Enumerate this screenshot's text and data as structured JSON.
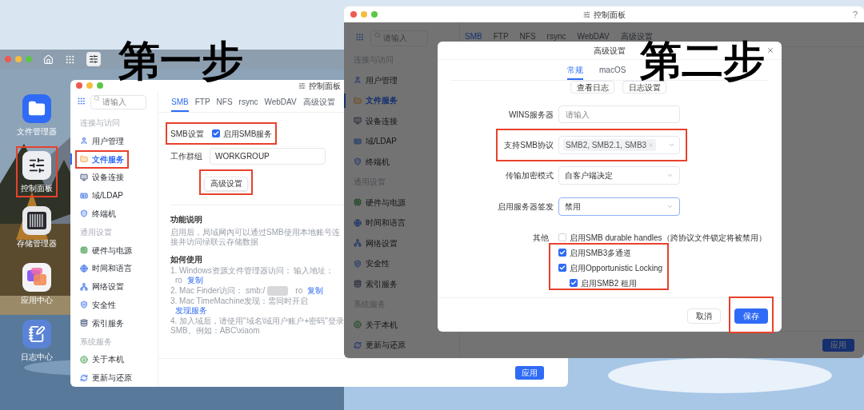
{
  "step_labels": [
    {
      "text": "第一步"
    },
    {
      "text": "第二步"
    }
  ],
  "desktop": {
    "dock": [
      {
        "kind": "files",
        "label": "文件管理器"
      },
      {
        "kind": "control",
        "label": "控制面板"
      },
      {
        "kind": "storage",
        "label": "存储管理器"
      },
      {
        "kind": "apps",
        "label": "应用中心"
      },
      {
        "kind": "logs",
        "label": "日志中心"
      }
    ]
  },
  "window_1": {
    "title": "控制面板",
    "search": {
      "placeholder": "请输入"
    },
    "sidebar": [
      {
        "kind": "group",
        "label": "连接与访问"
      },
      {
        "kind": "item",
        "label": "用户管理",
        "selected": false
      },
      {
        "kind": "item",
        "label": "文件服务",
        "selected": true
      },
      {
        "kind": "item",
        "label": "设备连接",
        "selected": false
      },
      {
        "kind": "item",
        "label": "域/LDAP",
        "selected": false
      },
      {
        "kind": "item",
        "label": "终端机",
        "selected": false
      },
      {
        "kind": "group",
        "label": "通用设置"
      },
      {
        "kind": "item",
        "label": "硬件与电源",
        "selected": false
      },
      {
        "kind": "item",
        "label": "时间和语言",
        "selected": false
      },
      {
        "kind": "item",
        "label": "网络设置",
        "selected": false
      },
      {
        "kind": "item",
        "label": "安全性",
        "selected": false
      },
      {
        "kind": "item",
        "label": "索引服务",
        "selected": false
      },
      {
        "kind": "group",
        "label": "系统服务"
      },
      {
        "kind": "item",
        "label": "关于本机",
        "selected": false
      },
      {
        "kind": "item",
        "label": "更新与还原",
        "selected": false
      }
    ],
    "tabs": [
      {
        "label": "SMB",
        "selected": true
      },
      {
        "label": "FTP",
        "selected": false
      },
      {
        "label": "NFS",
        "selected": false
      },
      {
        "label": "rsync",
        "selected": false
      },
      {
        "label": "WebDAV",
        "selected": false
      },
      {
        "label": "高级设置",
        "selected": false
      }
    ],
    "smb_settings": {
      "label": "SMB设置",
      "checkbox": {
        "label": "启用SMB服务",
        "checked": true
      }
    },
    "workgroup": {
      "label": "工作群组",
      "value": "WORKGROUP"
    },
    "advanced_button": "高级设置",
    "description": {
      "title": "功能说明",
      "text": "启用后，局域网内可以通过SMB使用本地账号连接并访问绿联云存储数据"
    },
    "usage": {
      "title": "如何使用",
      "steps": [
        {
          "text": "1. Windows资源文件管理器访问：  输入地址：",
          "redacted": false,
          "address": "ro",
          "link": "复制"
        },
        {
          "text": "2. Mac Finder访问：  smb:/",
          "redacted": true,
          "address": "ro",
          "link": "复制"
        },
        {
          "text": "3. Mac TimeMachine发现：需同时开启",
          "redacted": false,
          "link": "发现服务"
        },
        {
          "text": "4. 加入域后，请使用\"域名\\域用户账户+密码\"登录 SMB。例如：ABC\\xiaom",
          "redacted": false
        }
      ]
    },
    "apply_button": "应用"
  },
  "window_2": {
    "title": "控制面板",
    "help": "?",
    "search": {
      "placeholder": "请输入"
    },
    "sidebar": [
      {
        "kind": "group",
        "label": "连接与访问"
      },
      {
        "kind": "item",
        "label": "用户管理",
        "selected": false
      },
      {
        "kind": "item",
        "label": "文件服务",
        "selected": true
      },
      {
        "kind": "item",
        "label": "设备连接",
        "selected": false
      },
      {
        "kind": "item",
        "label": "域/LDAP",
        "selected": false
      },
      {
        "kind": "item",
        "label": "终端机",
        "selected": false
      },
      {
        "kind": "group",
        "label": "通用设置"
      },
      {
        "kind": "item",
        "label": "硬件与电源",
        "selected": false
      },
      {
        "kind": "item",
        "label": "时间和语言",
        "selected": false
      },
      {
        "kind": "item",
        "label": "网络设置",
        "selected": false
      },
      {
        "kind": "item",
        "label": "安全性",
        "selected": false
      },
      {
        "kind": "item",
        "label": "索引服务",
        "selected": false
      },
      {
        "kind": "group",
        "label": "系统服务"
      },
      {
        "kind": "item",
        "label": "关于本机",
        "selected": false
      },
      {
        "kind": "item",
        "label": "更新与还原",
        "selected": false
      }
    ],
    "tabs": [
      {
        "label": "SMB",
        "selected": true
      },
      {
        "label": "FTP",
        "selected": false
      },
      {
        "label": "NFS",
        "selected": false
      },
      {
        "label": "rsync",
        "selected": false
      },
      {
        "label": "WebDAV",
        "selected": false
      },
      {
        "label": "高级设置",
        "selected": false
      }
    ],
    "apply_button": "应用",
    "dialog": {
      "title": "高级设置",
      "tabs": [
        {
          "label": "常规",
          "selected": true
        },
        {
          "label": "macOS",
          "selected": false
        }
      ],
      "log_buttons": [
        "查看日志",
        "日志设置"
      ],
      "fields": [
        {
          "kind": "input",
          "label": "WINS服务器",
          "placeholder": "请输入"
        },
        {
          "kind": "tags",
          "label": "支持SMB协议",
          "tags": [
            "SMB2, SMB2.1, SMB3"
          ]
        },
        {
          "kind": "select",
          "label": "传输加密模式",
          "value": "自客户端决定",
          "focused": false
        },
        {
          "kind": "select",
          "label": "启用服务器签发",
          "value": "禁用",
          "focused": true
        }
      ],
      "other": {
        "label": "其他",
        "options": [
          {
            "label": "启用SMB durable handles（跨协议文件锁定将被禁用）",
            "checked": false
          },
          {
            "label": "启用SMB3多通道",
            "checked": true
          },
          {
            "label": "启用Opportunistic Locking",
            "checked": true,
            "children": [
              {
                "label": "启用SMB2 租用",
                "checked": true
              }
            ]
          }
        ]
      },
      "buttons": [
        {
          "kind": "secondary",
          "label": "取消"
        },
        {
          "kind": "primary",
          "label": "保存"
        }
      ]
    }
  }
}
